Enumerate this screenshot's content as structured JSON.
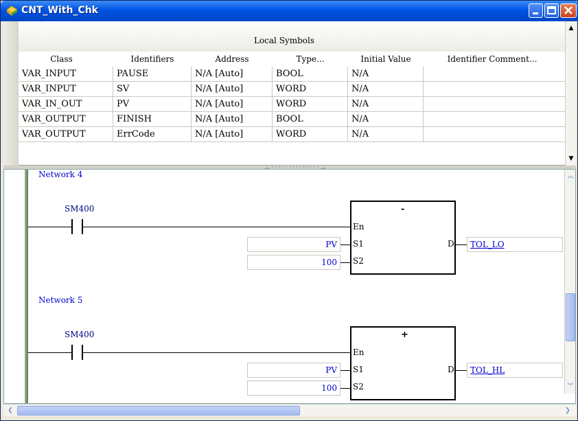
{
  "window": {
    "title": "CNT_With_Chk"
  },
  "symbols": {
    "section_title": "Local Symbols",
    "columns": [
      "Class",
      "Identifiers",
      "Address",
      "Type...",
      "Initial Value",
      "Identifier Comment..."
    ],
    "rows": [
      [
        "VAR_INPUT",
        "PAUSE",
        "N/A [Auto]",
        "BOOL",
        "N/A",
        ""
      ],
      [
        "VAR_INPUT",
        "SV",
        "N/A [Auto]",
        "WORD",
        "N/A",
        ""
      ],
      [
        "VAR_IN_OUT",
        "PV",
        "N/A [Auto]",
        "WORD",
        "N/A",
        ""
      ],
      [
        "VAR_OUTPUT",
        "FINISH",
        "N/A [Auto]",
        "BOOL",
        "N/A",
        ""
      ],
      [
        "VAR_OUTPUT",
        "ErrCode",
        "N/A [Auto]",
        "WORD",
        "N/A",
        ""
      ]
    ]
  },
  "networks": [
    {
      "label": "Network 4",
      "contact": "SM400",
      "op": "-",
      "pin_en": "En",
      "pin_s1": "S1",
      "pin_s2": "S2",
      "pin_d": "D",
      "s1": "PV",
      "s2": "100",
      "d": "TOL_LO"
    },
    {
      "label": "Network 5",
      "contact": "SM400",
      "op": "+",
      "pin_en": "En",
      "pin_s1": "S1",
      "pin_s2": "S2",
      "pin_d": "D",
      "s1": "PV",
      "s2": "100",
      "d": "TOL_HL"
    }
  ],
  "colors": {
    "titlebar": "#0054e3",
    "operand_text": "#0000cc",
    "rail": "#5e7a53"
  }
}
